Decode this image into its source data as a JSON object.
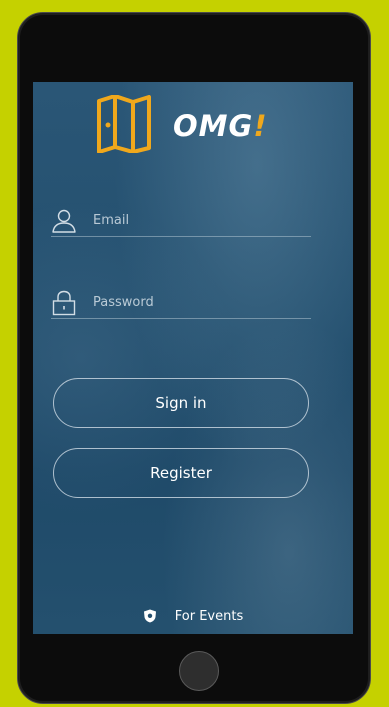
{
  "app": {
    "name": "OMG",
    "name_suffix": "!"
  },
  "form": {
    "email": {
      "placeholder": "Email",
      "value": "",
      "icon": "user-icon"
    },
    "password": {
      "placeholder": "Password",
      "value": "",
      "icon": "lock-icon"
    }
  },
  "actions": {
    "signin_label": "Sign in",
    "register_label": "Register"
  },
  "footer": {
    "link_label": "For Events",
    "icon": "shield-icon"
  },
  "colors": {
    "page_background": "#c5d100",
    "screen_background": "#24506f",
    "accent": "#f0a81c",
    "text": "#ffffff"
  }
}
